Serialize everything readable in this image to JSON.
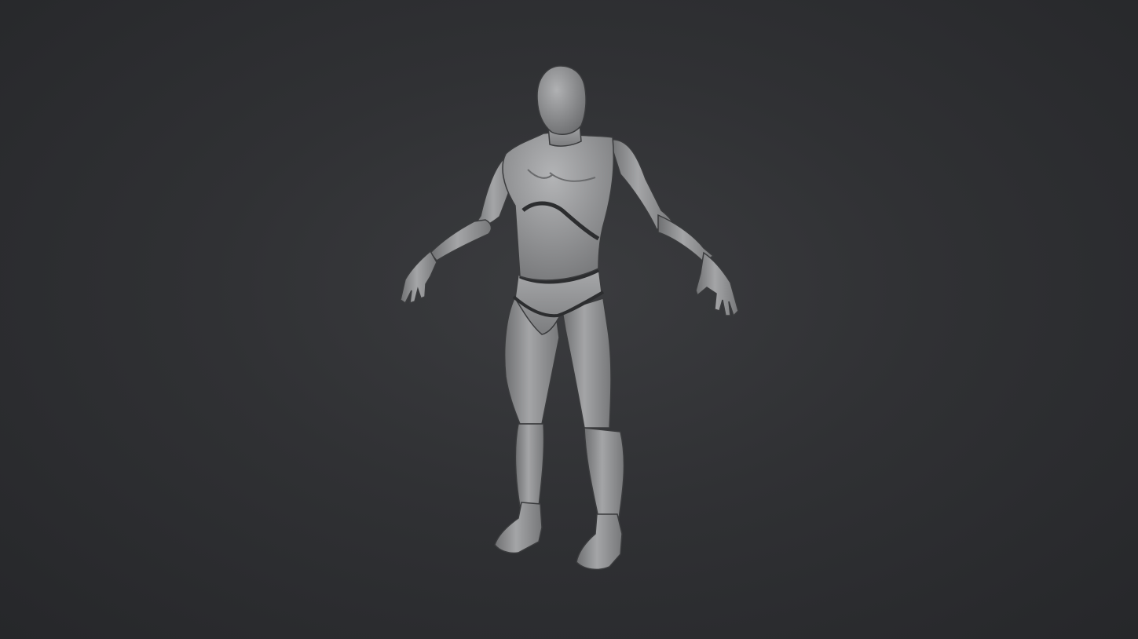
{
  "scene": {
    "background_color": "#2f3033",
    "model_color": "#8c8d8f",
    "model_highlight": "#b8b9bb",
    "model_shadow": "#4a4b4d",
    "subject": "mannequin-figure-a-pose"
  }
}
